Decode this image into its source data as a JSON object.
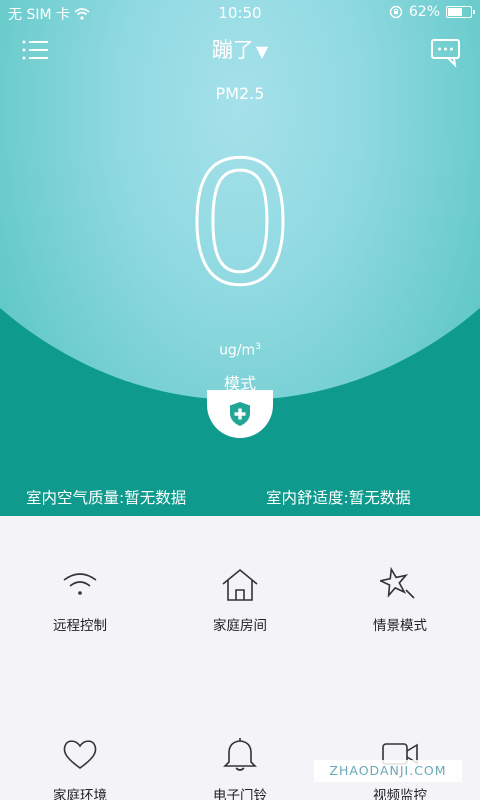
{
  "status_bar": {
    "carrier": "无 SIM 卡",
    "time": "10:50",
    "battery_text": "62%",
    "battery_level": 0.62
  },
  "header": {
    "title": "蹦了"
  },
  "reading": {
    "label": "PM2.5",
    "value": "0",
    "unit": "ug/m",
    "unit_sup": "3",
    "mode_label": "模式"
  },
  "stats": {
    "air_quality": "室内空气质量:暂无数据",
    "comfort": "室内舒适度:暂无数据"
  },
  "features": [
    {
      "label": "远程控制",
      "icon": "wifi-icon"
    },
    {
      "label": "家庭房间",
      "icon": "home-icon"
    },
    {
      "label": "情景模式",
      "icon": "star-icon"
    },
    {
      "label": "家庭环境",
      "icon": "heart-icon"
    },
    {
      "label": "电子门铃",
      "icon": "bell-icon"
    },
    {
      "label": "视频监控",
      "icon": "camera-icon"
    }
  ],
  "watermark": "ZHAODANJI.COM",
  "colors": {
    "teal_dark": "#0e9a8c",
    "teal_light": "#8fd9e1",
    "icon_teal": "#21a698"
  }
}
